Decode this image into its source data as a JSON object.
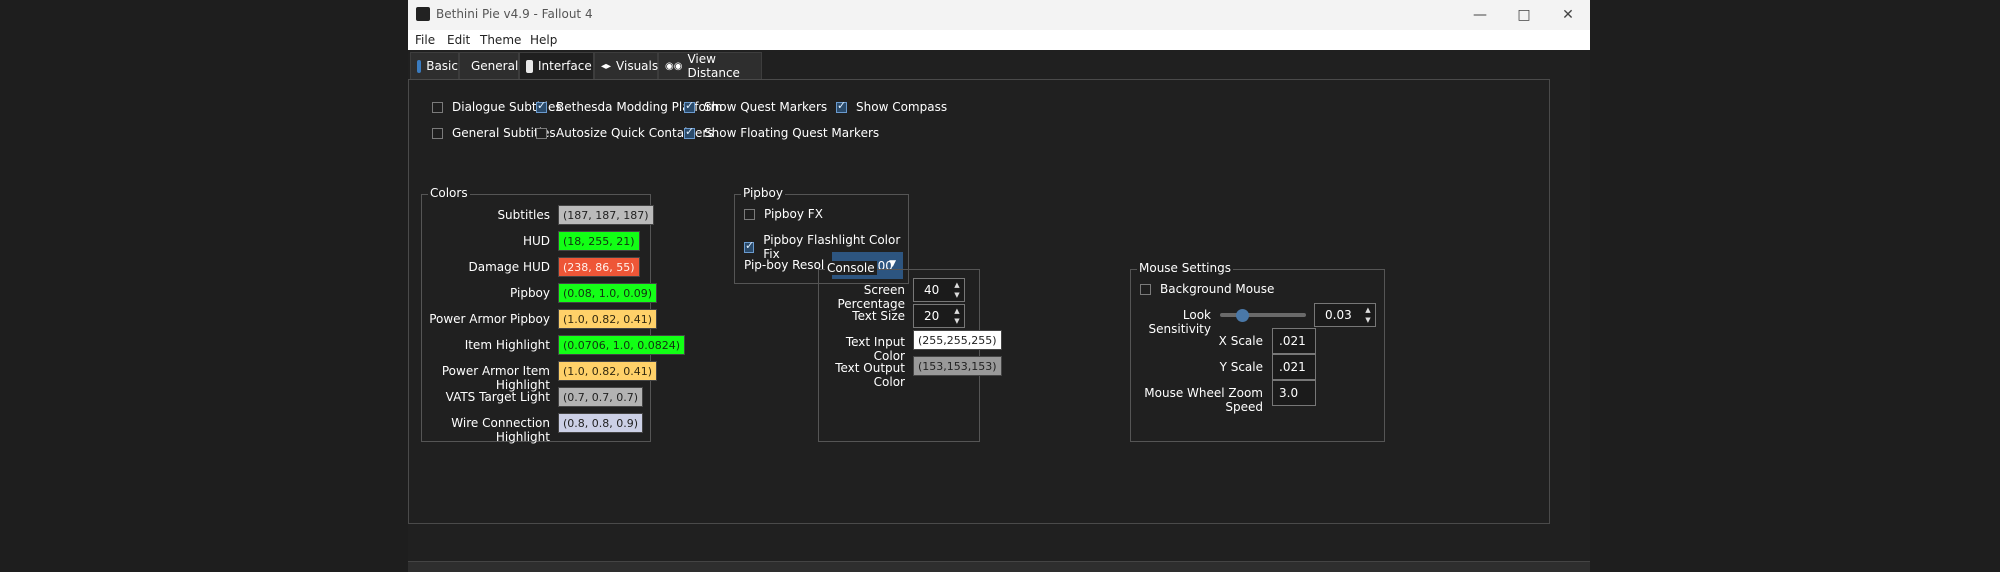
{
  "window": {
    "title": "Bethini Pie v4.9 - Fallout 4"
  },
  "menu": [
    "File",
    "Edit",
    "Theme",
    "Help"
  ],
  "tabs": [
    {
      "label": "Basic",
      "icon": "basic-icon"
    },
    {
      "label": "General",
      "icon": "general-icon"
    },
    {
      "label": "Interface",
      "icon": "interface-icon",
      "active": true
    },
    {
      "label": "Visuals",
      "icon": "visuals-icon"
    },
    {
      "label": "View Distance",
      "icon": "view-distance-icon"
    }
  ],
  "checkboxes": [
    {
      "label": "Dialogue Subtitles",
      "checked": false
    },
    {
      "label": "Bethesda Modding Platform",
      "checked": true
    },
    {
      "label": "Show Quest Markers",
      "checked": true
    },
    {
      "label": "Show Compass",
      "checked": true
    },
    {
      "label": "General Subtitles",
      "checked": false
    },
    {
      "label": "Autosize Quick Containers",
      "checked": false
    },
    {
      "label": "Show Floating Quest Markers",
      "checked": true
    }
  ],
  "colors": {
    "legend": "Colors",
    "items": [
      {
        "label": "Subtitles",
        "value": "(187, 187, 187)",
        "bg": "#bbbbbb",
        "fg": "#222222"
      },
      {
        "label": "HUD",
        "value": "(18, 255, 21)",
        "bg": "#12ff15",
        "fg": "#113311"
      },
      {
        "label": "Damage HUD",
        "value": "(238, 86, 55)",
        "bg": "#ee5637",
        "fg": "#fff1ec"
      },
      {
        "label": "Pipboy",
        "value": "(0.08, 1.0, 0.09)",
        "bg": "#14ff17",
        "fg": "#113311"
      },
      {
        "label": "Power Armor Pipboy",
        "value": "(1.0, 0.82, 0.41)",
        "bg": "#ffd169",
        "fg": "#332a10"
      },
      {
        "label": "Item Highlight",
        "value": "(0.0706, 1.0, 0.0824)",
        "bg": "#12ff15",
        "fg": "#113311"
      },
      {
        "label": "Power Armor Item Highlight",
        "value": "(1.0, 0.82, 0.41)",
        "bg": "#ffd169",
        "fg": "#332a10"
      },
      {
        "label": "VATS Target Light",
        "value": "(0.7, 0.7, 0.7)",
        "bg": "#b3b3b3",
        "fg": "#222222"
      },
      {
        "label": "Wire Connection Highlight",
        "value": "(0.8, 0.8, 0.9)",
        "bg": "#ccd0e6",
        "fg": "#222222"
      }
    ]
  },
  "pipboy": {
    "legend": "Pipboy",
    "fx_label": "Pipboy FX",
    "fx_checked": false,
    "flashlight_label": "Pipboy Flashlight Color Fix",
    "flashlight_checked": true,
    "resolution_label": "Pip-boy Resolution",
    "resolution_value": "876x700"
  },
  "console": {
    "legend": "Console",
    "screen_pct_label": "Screen Percentage",
    "screen_pct_value": "40",
    "text_size_label": "Text Size",
    "text_size_value": "20",
    "input_color_label": "Text Input Color",
    "input_color_value": "(255,255,255)",
    "output_color_label": "Text Output Color",
    "output_color_value": "(153,153,153)"
  },
  "mouse": {
    "legend": "Mouse Settings",
    "background_label": "Background Mouse",
    "background_checked": false,
    "sensitivity_label": "Look Sensitivity",
    "sensitivity_value": "0.03",
    "sensitivity_fraction": 0.25,
    "x_scale_label": "X Scale",
    "x_scale_value": ".021",
    "y_scale_label": "Y Scale",
    "y_scale_value": ".021",
    "zoom_label": "Mouse Wheel Zoom Speed",
    "zoom_value": "3.0"
  }
}
